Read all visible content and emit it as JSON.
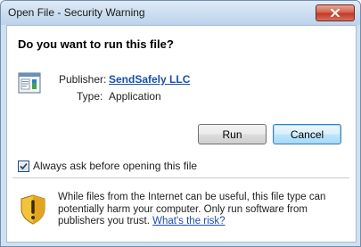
{
  "window": {
    "title": "Open File - Security Warning"
  },
  "question": "Do you want to run this file?",
  "file": {
    "publisher_label": "Publisher:",
    "publisher_value": "SendSafely LLC",
    "type_label": "Type:",
    "type_value": "Application"
  },
  "buttons": {
    "run": "Run",
    "cancel": "Cancel"
  },
  "checkbox": {
    "label": "Always ask before opening this file",
    "checked": true
  },
  "warning": {
    "text": "While files from the Internet can be useful, this file type can potentially harm your computer. Only run software from publishers you trust.",
    "link": "What's the risk?"
  },
  "colors": {
    "link": "#1a4fa8",
    "close_button": "#c0392b"
  },
  "icons": {
    "close": "close-icon",
    "file": "application-file-icon",
    "shield": "security-shield-icon",
    "check": "check-icon"
  }
}
